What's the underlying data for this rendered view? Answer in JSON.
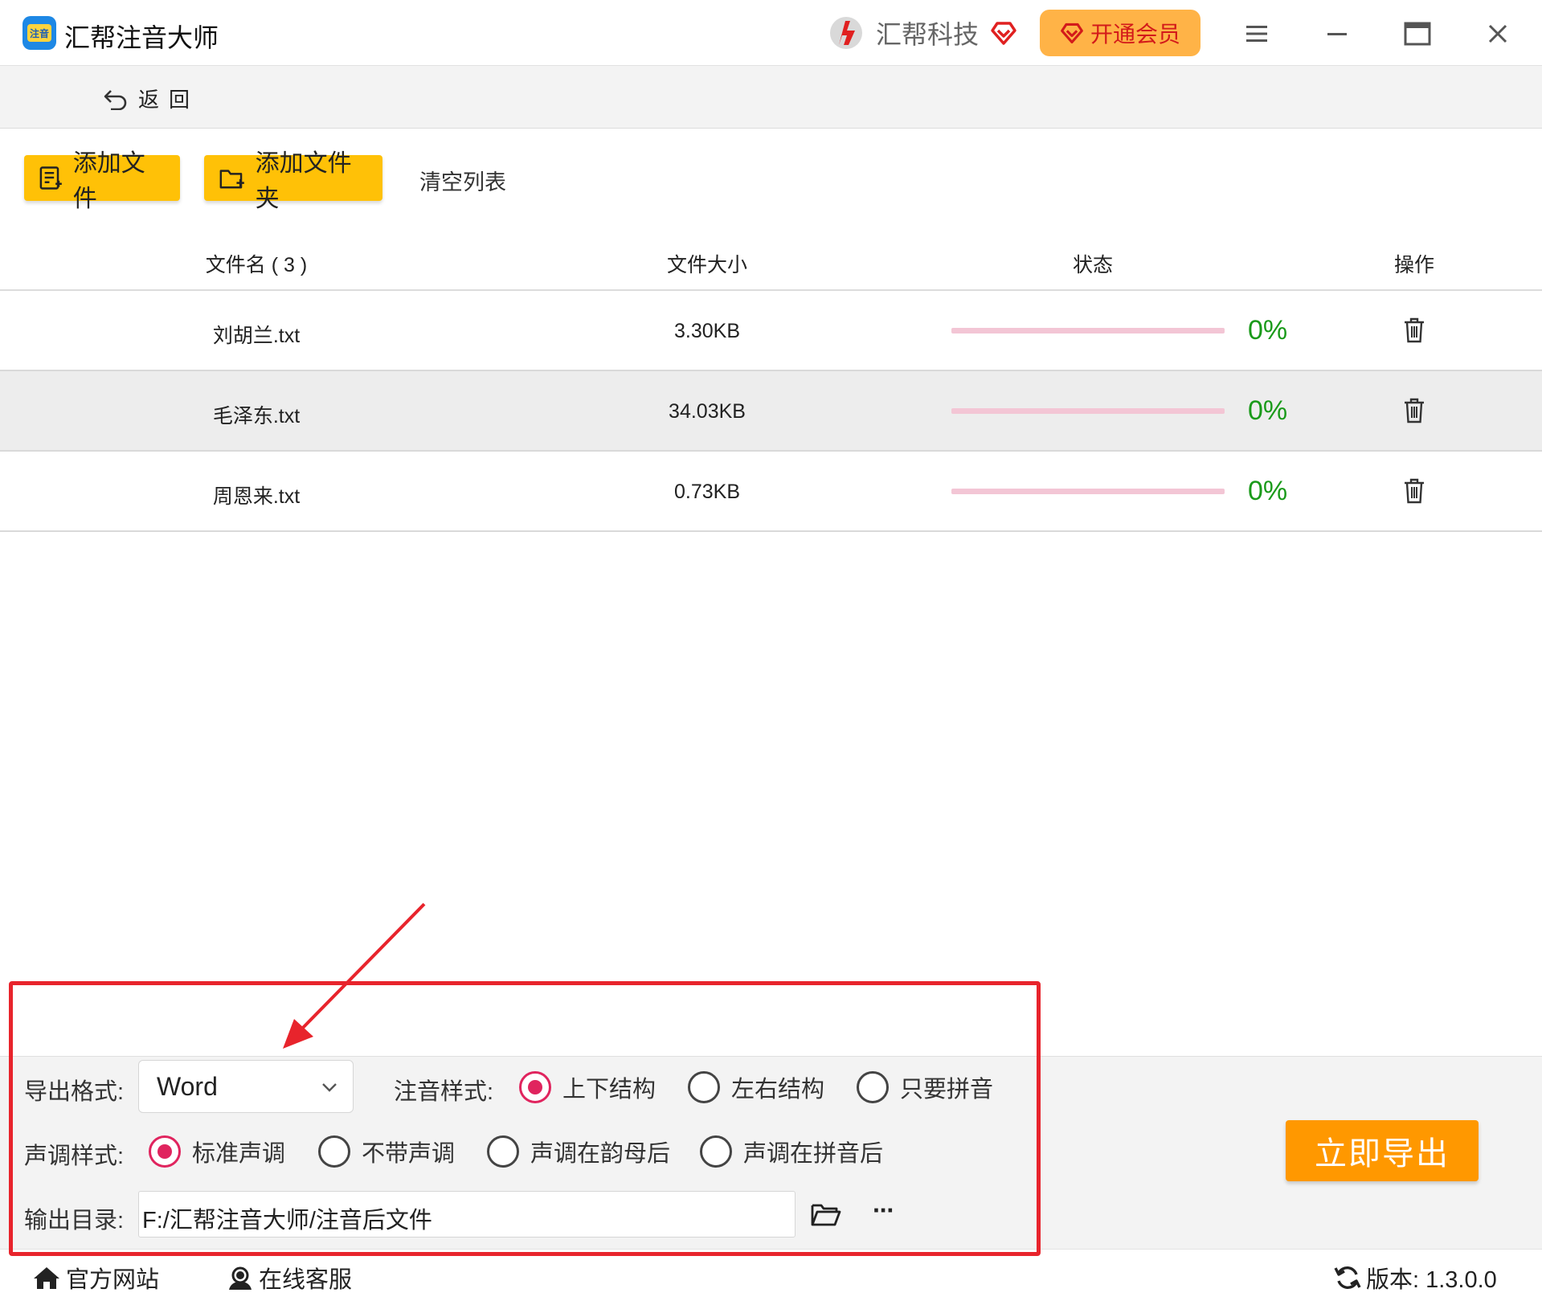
{
  "app": {
    "title": "汇帮注音大师",
    "logo_text": "注音"
  },
  "brand": {
    "name": "汇帮科技"
  },
  "titlebar": {
    "vip_label": "开通会员"
  },
  "nav": {
    "back_label": "返回"
  },
  "toolbar": {
    "add_file": "添加文件",
    "add_folder": "添加文件夹",
    "clear_list": "清空列表"
  },
  "table": {
    "headers": {
      "name": "文件名 ( 3 )",
      "size": "文件大小",
      "status": "状态",
      "action": "操作"
    },
    "rows": [
      {
        "name": "刘胡兰.txt",
        "size": "3.30KB",
        "progress": "0%"
      },
      {
        "name": "毛泽东.txt",
        "size": "34.03KB",
        "progress": "0%"
      },
      {
        "name": "周恩来.txt",
        "size": "0.73KB",
        "progress": "0%"
      }
    ]
  },
  "settings": {
    "format_label": "导出格式:",
    "format_value": "Word",
    "style_label": "注音样式:",
    "style_options": [
      "上下结构",
      "左右结构",
      "只要拼音"
    ],
    "style_selected": "上下结构",
    "tone_label": "声调样式:",
    "tone_options": [
      "标准声调",
      "不带声调",
      "声调在韵母后",
      "声调在拼音后"
    ],
    "tone_selected": "标准声调",
    "output_label": "输出目录:",
    "output_path": "F:/汇帮注音大师/注音后文件",
    "more_label": "···",
    "export_label": "立即导出"
  },
  "footer": {
    "website": "官方网站",
    "support": "在线客服",
    "version": "版本:  1.3.0.0"
  },
  "colors": {
    "accent_yellow": "#ffc107",
    "export_orange": "#ff9800",
    "radio_checked": "#e0245e",
    "progress_text": "#1a9a1a",
    "annotation_red": "#e8242c"
  }
}
